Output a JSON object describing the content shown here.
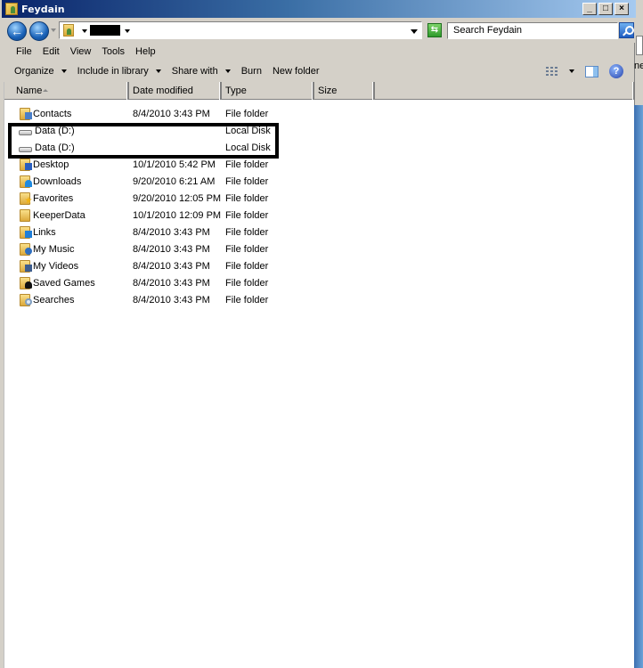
{
  "window": {
    "title": "Feydain",
    "controls": {
      "minimize": "_",
      "maximize": "□",
      "close": "×"
    }
  },
  "addressbar": {
    "back_icon": "back-arrow-icon",
    "forward_icon": "forward-arrow-icon",
    "refresh_icon": "refresh-icon",
    "search_placeholder": "Search Feydain",
    "search_icon": "search-icon"
  },
  "menubar": {
    "items": [
      "File",
      "Edit",
      "View",
      "Tools",
      "Help"
    ]
  },
  "commandbar": {
    "organize": "Organize",
    "include_in_library": "Include in library",
    "share_with": "Share with",
    "burn": "Burn",
    "new_folder": "New folder",
    "views_icon": "views-icon",
    "preview_pane_icon": "preview-pane-icon",
    "help_icon": "help-icon",
    "help_glyph": "?"
  },
  "columns": {
    "name": "Name",
    "date_modified": "Date modified",
    "type": "Type",
    "size": "Size"
  },
  "files": [
    {
      "name": "Contacts",
      "date": "8/4/2010 3:43 PM",
      "type": "File folder",
      "icon": "contacts-folder-icon"
    },
    {
      "name": "Data (D:)",
      "date": "",
      "type": "Local Disk",
      "icon": "local-disk-icon"
    },
    {
      "name": "Data (D:)",
      "date": "",
      "type": "Local Disk",
      "icon": "local-disk-icon"
    },
    {
      "name": "Desktop",
      "date": "10/1/2010 5:42 PM",
      "type": "File folder",
      "icon": "desktop-folder-icon"
    },
    {
      "name": "Downloads",
      "date": "9/20/2010 6:21 AM",
      "type": "File folder",
      "icon": "downloads-folder-icon"
    },
    {
      "name": "Favorites",
      "date": "9/20/2010 12:05 PM",
      "type": "File folder",
      "icon": "favorites-folder-icon"
    },
    {
      "name": "KeeperData",
      "date": "10/1/2010 12:09 PM",
      "type": "File folder",
      "icon": "folder-icon"
    },
    {
      "name": "Links",
      "date": "8/4/2010 3:43 PM",
      "type": "File folder",
      "icon": "links-folder-icon"
    },
    {
      "name": "My Music",
      "date": "8/4/2010 3:43 PM",
      "type": "File folder",
      "icon": "music-folder-icon"
    },
    {
      "name": "My Videos",
      "date": "8/4/2010 3:43 PM",
      "type": "File folder",
      "icon": "videos-folder-icon"
    },
    {
      "name": "Saved Games",
      "date": "8/4/2010 3:43 PM",
      "type": "File folder",
      "icon": "saved-games-folder-icon"
    },
    {
      "name": "Searches",
      "date": "8/4/2010 3:43 PM",
      "type": "File folder",
      "icon": "searches-folder-icon"
    }
  ],
  "colors": {
    "titlebar_start": "#0a246a",
    "titlebar_end": "#a6caf0",
    "chrome": "#d4d0c8",
    "highlight_box": "#000000"
  }
}
